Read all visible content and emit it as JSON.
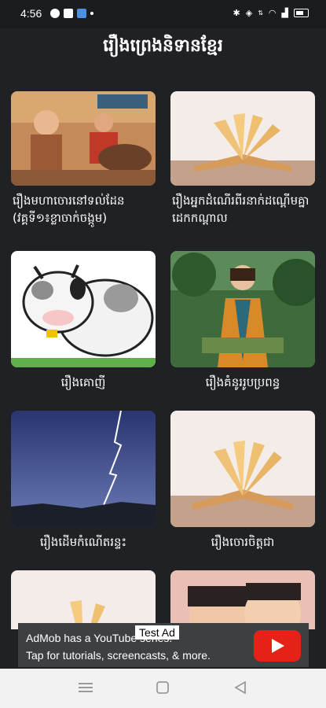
{
  "status_bar": {
    "time": "4:56",
    "icons": [
      "facebook-icon",
      "app-icon",
      "app-icon",
      "dot",
      "bluetooth-icon",
      "vibrate-icon",
      "data-speed",
      "wifi-icon",
      "signal-icon",
      "battery-icon"
    ]
  },
  "header": {
    "title": "រឿងព្រេងនិទានខ្មែរ"
  },
  "stories": [
    {
      "title": "រឿងមហាចោរនៅទល់ដែន (វគ្គទី១៖ខ្លាចាក់ចង្កូម)"
    },
    {
      "title": "រឿងអ្នកដំណើរពីរនាក់ដណ្តើមគ្នាដេកកណ្តាល"
    },
    {
      "title": "រឿងគោញី"
    },
    {
      "title": "រឿងគំនូររូបប្រពន្ធ"
    },
    {
      "title": "រឿងដើមកំណើតរន្ទះ"
    },
    {
      "title": "រឿងចោរចិត្តជា"
    }
  ],
  "ad": {
    "text": "AdMob has a YouTube series!\nTap for tutorials, screencasts, & more.",
    "label": "Test Ad"
  },
  "colors": {
    "background": "#202124",
    "ad_bg": "#3c4043",
    "play": "#e62117"
  }
}
